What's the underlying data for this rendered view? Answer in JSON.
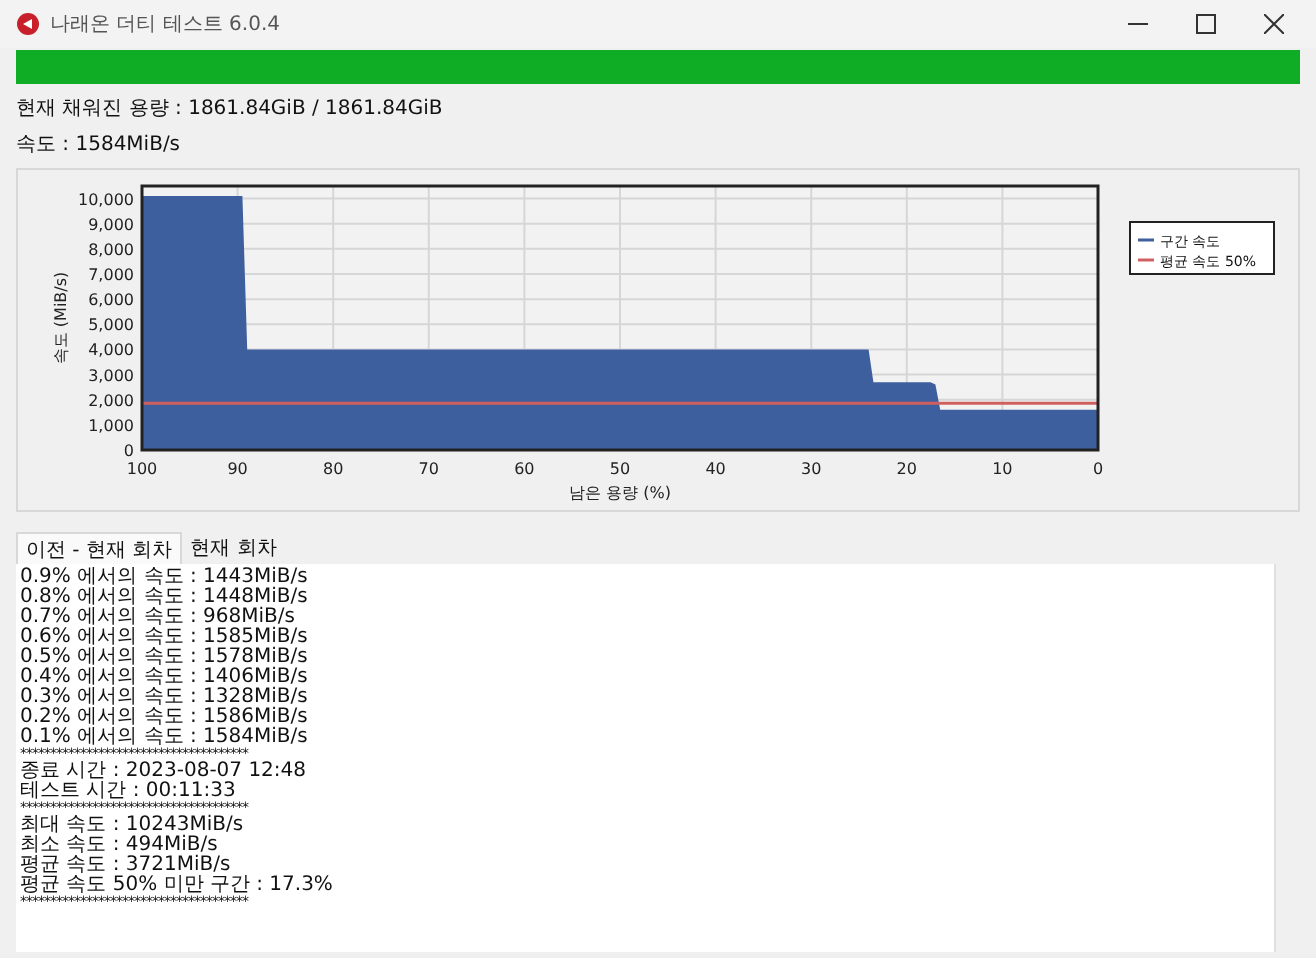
{
  "window": {
    "title": "나래온 더티 테스트 6.0.4"
  },
  "progress": {
    "level": 1
  },
  "info": [
    "현재 채워진 용량 : 1861.84GiB / 1861.84GiB",
    "속도 : 1584MiB/s"
  ],
  "chart_data": {
    "type": "area",
    "xlabel": "남은 용량 (%)",
    "ylabel": "속도 (MiB/s)",
    "grid": true,
    "legend": true,
    "xlim": [
      100,
      0
    ],
    "ylim": [
      0,
      10500
    ],
    "xticks": [
      100,
      90,
      80,
      70,
      60,
      50,
      40,
      30,
      20,
      10,
      0
    ],
    "yticks": [
      0,
      {
        "value": 1000,
        "label": "1,000"
      },
      {
        "value": 2000,
        "label": "2,000"
      },
      {
        "value": 3000,
        "label": "3,000"
      },
      {
        "value": 4000,
        "label": "4,000"
      },
      {
        "value": 5000,
        "label": "5,000"
      },
      {
        "value": 6000,
        "label": "6,000"
      },
      {
        "value": 7000,
        "label": "7,000"
      },
      {
        "value": 8000,
        "label": "8,000"
      },
      {
        "value": 9000,
        "label": "9,000"
      },
      {
        "value": 10000,
        "label": "10,000"
      }
    ],
    "x": [
      100,
      89.5,
      89,
      24,
      23.5,
      17.5,
      17,
      16.5,
      0
    ],
    "series": [
      {
        "name": "구간 속도",
        "color": "#3d5f9e",
        "values": [
          10100,
          10100,
          4000,
          4000,
          2700,
          2700,
          2600,
          1600,
          1600
        ]
      },
      {
        "name": "평균 속도 50%",
        "type": "line",
        "color": "#d06060",
        "values": [
          1860,
          1860,
          1860,
          1860,
          1860,
          1860,
          1860,
          1860,
          1860
        ]
      }
    ]
  },
  "tabs": [
    {
      "label": "이전 - 현재 회차",
      "selected": true
    },
    {
      "label": "현재 회차",
      "selected": false
    }
  ],
  "log": [
    {
      "kind": "text",
      "text": "0.9% 에서의 속도 : 1443MiB/s"
    },
    {
      "kind": "text",
      "text": "0.8% 에서의 속도 : 1448MiB/s"
    },
    {
      "kind": "text",
      "text": "0.7% 에서의 속도 : 968MiB/s"
    },
    {
      "kind": "text",
      "text": "0.6% 에서의 속도 : 1585MiB/s"
    },
    {
      "kind": "text",
      "text": "0.5% 에서의 속도 : 1578MiB/s"
    },
    {
      "kind": "text",
      "text": "0.4% 에서의 속도 : 1406MiB/s"
    },
    {
      "kind": "text",
      "text": "0.3% 에서의 속도 : 1328MiB/s"
    },
    {
      "kind": "text",
      "text": "0.2% 에서의 속도 : 1586MiB/s"
    },
    {
      "kind": "text",
      "text": "0.1% 에서의 속도 : 1584MiB/s"
    },
    {
      "kind": "rule",
      "text": "**************************************"
    },
    {
      "kind": "text",
      "text": "종료 시간 : 2023-08-07 12:48"
    },
    {
      "kind": "text",
      "text": "테스트 시간 : 00:11:33"
    },
    {
      "kind": "rule",
      "text": "**************************************"
    },
    {
      "kind": "text",
      "text": "최대 속도 : 10243MiB/s"
    },
    {
      "kind": "text",
      "text": "최소 속도 : 494MiB/s"
    },
    {
      "kind": "text",
      "text": "평균 속도 : 3721MiB/s"
    },
    {
      "kind": "text",
      "text": "평균 속도 50% 미만 구간 : 17.3%"
    },
    {
      "kind": "rule",
      "text": "**************************************"
    }
  ]
}
